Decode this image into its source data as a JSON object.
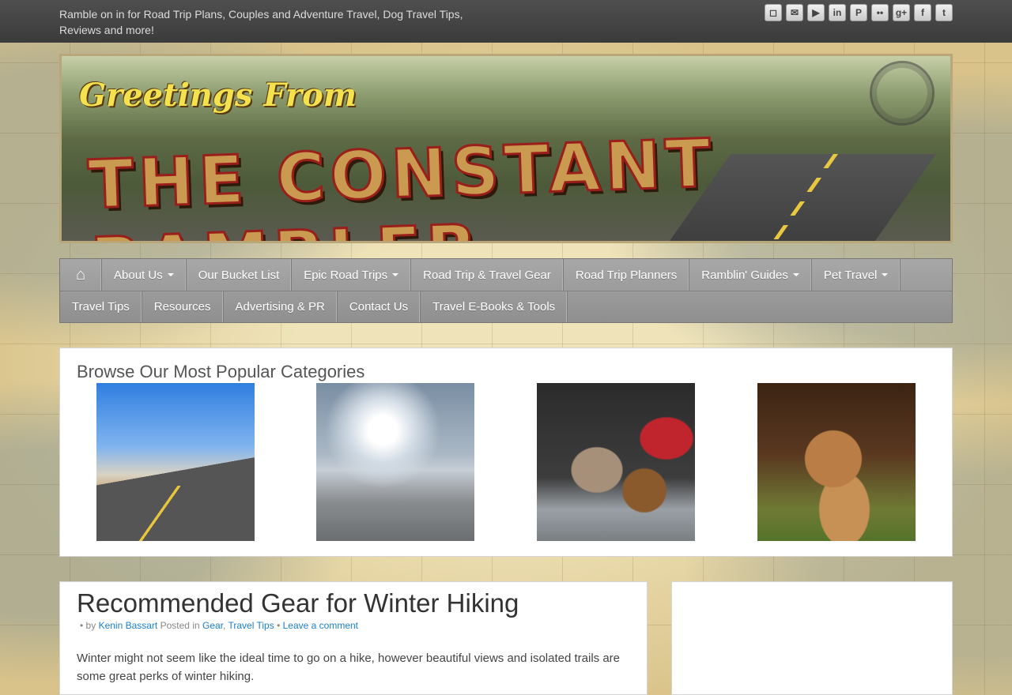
{
  "topbar": {
    "tagline": "Ramble on in for Road Trip Plans, Couples and Adventure Travel, Dog Travel Tips, Reviews and more!",
    "social_icons": [
      "instagram-icon",
      "email-icon",
      "youtube-icon",
      "linkedin-icon",
      "pinterest-icon",
      "flickr-icon",
      "google-plus-icon",
      "facebook-icon",
      "twitter-icon"
    ]
  },
  "banner": {
    "greeting": "Greetings From",
    "title": "THE CONSTANT RAMBLER"
  },
  "nav": {
    "home_icon": "home-icon",
    "row1": [
      {
        "label": "About Us",
        "dropdown": true
      },
      {
        "label": "Our Bucket List",
        "dropdown": false
      },
      {
        "label": "Epic Road Trips",
        "dropdown": true
      },
      {
        "label": "Road Trip & Travel Gear",
        "dropdown": false
      },
      {
        "label": "Road Trip Planners",
        "dropdown": false
      },
      {
        "label": "Ramblin' Guides",
        "dropdown": true
      },
      {
        "label": "Pet Travel",
        "dropdown": true
      }
    ],
    "row2": [
      {
        "label": "Travel Tips"
      },
      {
        "label": "Resources"
      },
      {
        "label": "Advertising & PR"
      },
      {
        "label": "Contact Us"
      },
      {
        "label": "Travel E-Books & Tools"
      }
    ]
  },
  "categories": {
    "heading": "Browse Our Most Popular Categories"
  },
  "article": {
    "title": "Recommended Gear for Winter Hiking",
    "by_prefix": "• by",
    "author": "Kenin Bassart",
    "posted_in": "Posted in",
    "cat1": "Gear",
    "cat2": "Travel Tips",
    "comment_link": "Leave a comment",
    "excerpt": "Winter might not seem like the ideal time to go on a hike, however beautiful views and isolated trails are some great perks of winter hiking."
  }
}
